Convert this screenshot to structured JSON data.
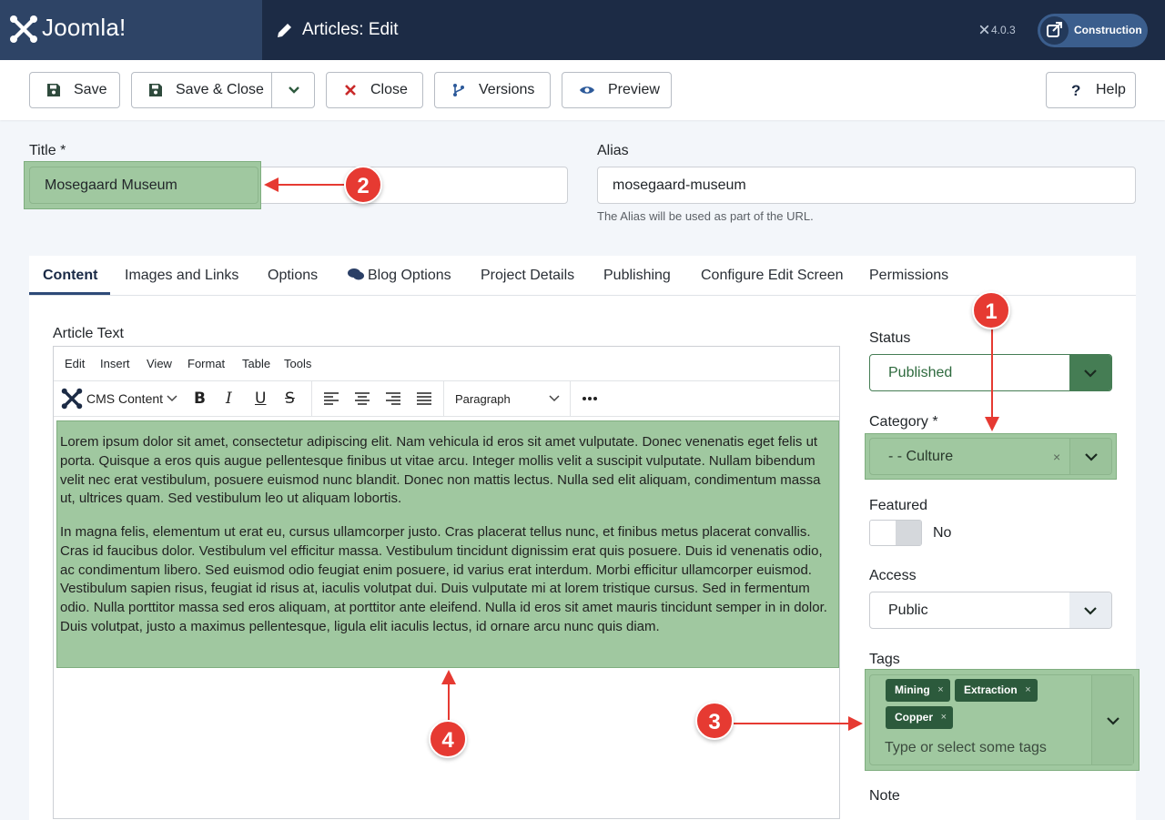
{
  "header": {
    "logo_text": "Joomla!",
    "page_title": "Articles: Edit",
    "version": "4.0.3",
    "site_button_label": "Construction"
  },
  "toolbar": {
    "save": "Save",
    "save_close": "Save & Close",
    "close": "Close",
    "versions": "Versions",
    "preview": "Preview",
    "help": "Help"
  },
  "form": {
    "title_label": "Title *",
    "title_value": "Mosegaard Museum",
    "alias_label": "Alias",
    "alias_value": "mosegaard-museum",
    "alias_hint": "The Alias will be used as part of the URL."
  },
  "tabs": [
    {
      "label": "Content"
    },
    {
      "label": "Images and Links"
    },
    {
      "label": "Options"
    },
    {
      "label": "Blog Options"
    },
    {
      "label": "Project Details"
    },
    {
      "label": "Publishing"
    },
    {
      "label": "Configure Edit Screen"
    },
    {
      "label": "Permissions"
    }
  ],
  "editor": {
    "label": "Article Text",
    "menu": [
      "Edit",
      "Insert",
      "View",
      "Format",
      "Table",
      "Tools"
    ],
    "cms_content": "CMS Content",
    "block_format": "Paragraph",
    "paragraphs": [
      "Lorem ipsum dolor sit amet, consectetur adipiscing elit. Nam vehicula id eros sit amet vulputate. Donec venenatis eget felis ut porta. Quisque a eros quis augue pellentesque finibus ut vitae arcu. Integer mollis velit a suscipit vulputate. Nullam bibendum velit nec erat vestibulum, posuere euismod nunc blandit. Donec non mattis lectus. Nulla sed elit aliquam, condimentum massa ut, ultrices quam. Sed vestibulum leo ut aliquam lobortis.",
      "In magna felis, elementum ut erat eu, cursus ullamcorper justo. Cras placerat tellus nunc, et finibus metus placerat convallis. Cras id faucibus dolor. Vestibulum vel efficitur massa. Vestibulum tincidunt dignissim erat quis posuere. Duis id venenatis odio, ac condimentum libero. Sed euismod odio feugiat enim posuere, id varius erat interdum. Morbi efficitur ullamcorper euismod. Vestibulum sapien risus, feugiat id risus at, iaculis volutpat dui. Duis vulputate mi at lorem tristique cursus. Sed in fermentum odio. Nulla porttitor massa sed eros aliquam, at porttitor ante eleifend. Nulla id eros sit amet mauris tincidunt semper in in dolor. Duis volutpat, justo a maximus pellentesque, ligula elit iaculis lectus, id ornare arcu nunc quis diam."
    ]
  },
  "sidebar": {
    "status_label": "Status",
    "status_value": "Published",
    "category_label": "Category *",
    "category_value": "- - Culture",
    "featured_label": "Featured",
    "featured_value": "No",
    "access_label": "Access",
    "access_value": "Public",
    "tags_label": "Tags",
    "tags": [
      "Mining",
      "Extraction",
      "Copper"
    ],
    "tags_placeholder": "Type or select some tags",
    "note_label": "Note"
  },
  "callouts": [
    "1",
    "2",
    "3",
    "4"
  ],
  "colors": {
    "header_bg": "#1c2b45",
    "highlight": "#a0c8a0",
    "published_green": "#457d54",
    "tag_green": "#2c5a3c",
    "callout_red": "#e63a32"
  }
}
